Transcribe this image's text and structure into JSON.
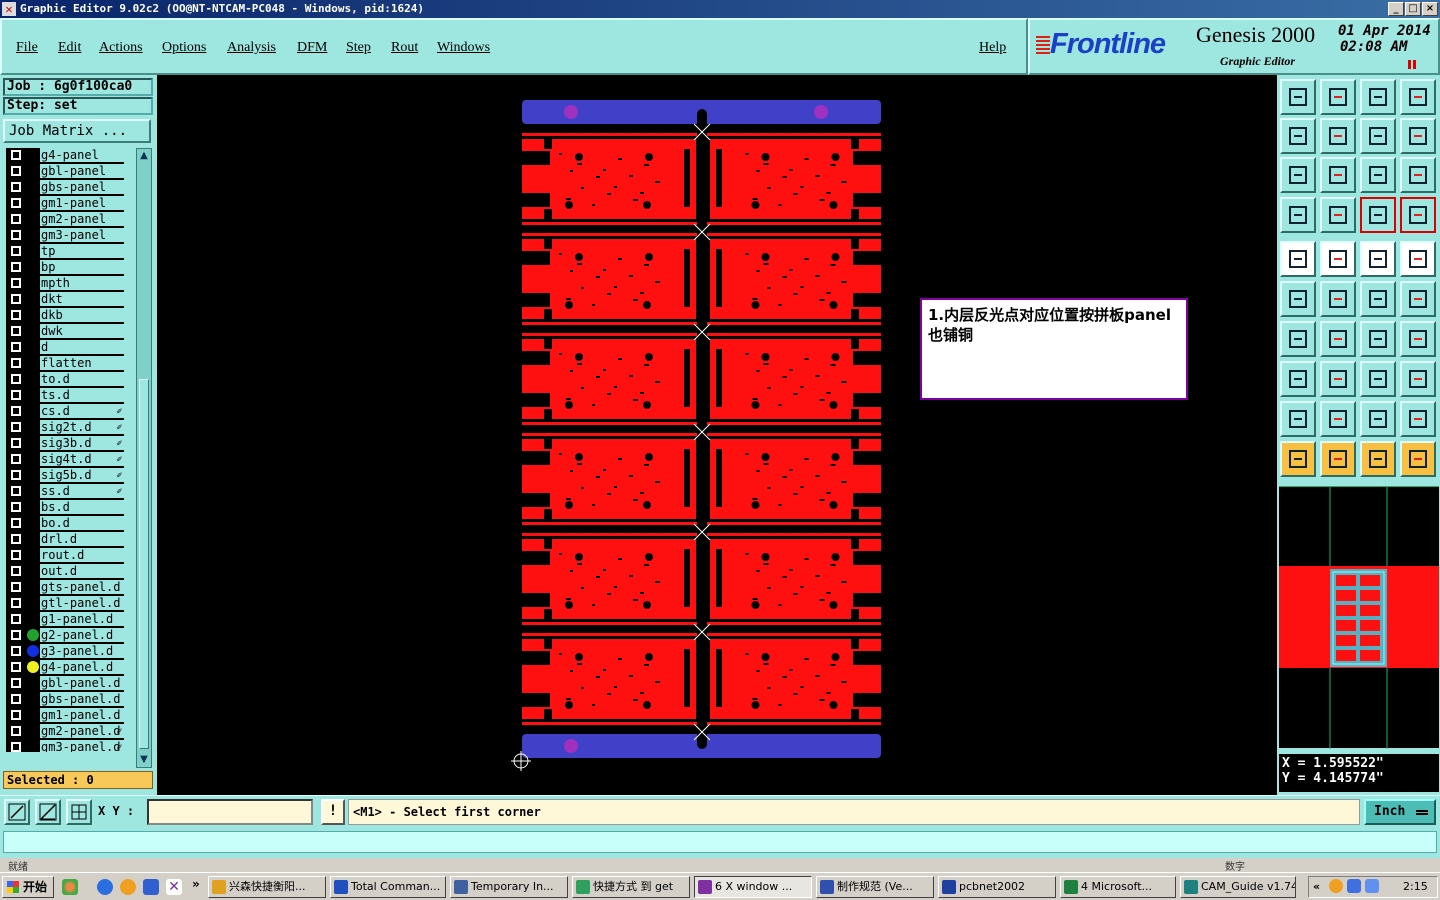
{
  "window": {
    "title": "Graphic Editor 9.02c2  (OO@NT-NTCAM-PC048 - Windows, pid:1624)",
    "buttons": {
      "minimize": "_",
      "maximize": "□",
      "close": "×"
    }
  },
  "menu": {
    "items": [
      {
        "label": "File"
      },
      {
        "label": "Edit"
      },
      {
        "label": "Actions"
      },
      {
        "label": "Options"
      },
      {
        "label": "Analysis"
      },
      {
        "label": "DFM"
      },
      {
        "label": "Step"
      },
      {
        "label": "Rout"
      },
      {
        "label": "Windows"
      }
    ],
    "help": "Help"
  },
  "brand": {
    "logo": "Frontline",
    "product": "Genesis 2000",
    "subtitle": "Graphic Editor",
    "date": "01 Apr 2014",
    "time": "02:08 AM"
  },
  "left": {
    "job": "Job : 6g0f100ca0",
    "step": "Step: set",
    "job_matrix": "Job Matrix ...",
    "selected": "Selected : 0",
    "layers": [
      {
        "name": "g4-panel",
        "color": "",
        "affected": false
      },
      {
        "name": "gbl-panel",
        "color": "",
        "affected": false
      },
      {
        "name": "gbs-panel",
        "color": "",
        "affected": false
      },
      {
        "name": "gm1-panel",
        "color": "",
        "affected": false
      },
      {
        "name": "gm2-panel",
        "color": "",
        "affected": false
      },
      {
        "name": "gm3-panel",
        "color": "",
        "affected": false
      },
      {
        "name": "tp",
        "color": "",
        "affected": false
      },
      {
        "name": "bp",
        "color": "",
        "affected": false
      },
      {
        "name": "mpth",
        "color": "",
        "affected": false
      },
      {
        "name": "dkt",
        "color": "",
        "affected": false
      },
      {
        "name": "dkb",
        "color": "",
        "affected": false
      },
      {
        "name": "dwk",
        "color": "",
        "affected": false
      },
      {
        "name": "d",
        "color": "",
        "affected": false
      },
      {
        "name": "flatten",
        "color": "",
        "affected": false
      },
      {
        "name": "to.d",
        "color": "",
        "affected": false
      },
      {
        "name": "ts.d",
        "color": "",
        "affected": false
      },
      {
        "name": "cs.d",
        "color": "",
        "affected": true
      },
      {
        "name": "sig2t.d",
        "color": "",
        "affected": true
      },
      {
        "name": "sig3b.d",
        "color": "",
        "affected": true
      },
      {
        "name": "sig4t.d",
        "color": "",
        "affected": true
      },
      {
        "name": "sig5b.d",
        "color": "",
        "affected": true
      },
      {
        "name": "ss.d",
        "color": "",
        "affected": true
      },
      {
        "name": "bs.d",
        "color": "",
        "affected": false
      },
      {
        "name": "bo.d",
        "color": "",
        "affected": false
      },
      {
        "name": "drl.d",
        "color": "",
        "affected": false
      },
      {
        "name": "rout.d",
        "color": "",
        "affected": false
      },
      {
        "name": "out.d",
        "color": "",
        "affected": false
      },
      {
        "name": "gts-panel.d",
        "color": "",
        "affected": false
      },
      {
        "name": "gtl-panel.d",
        "color": "",
        "affected": false
      },
      {
        "name": "g1-panel.d",
        "color": "",
        "affected": false
      },
      {
        "name": "g2-panel.d",
        "color": "#22a030",
        "affected": false
      },
      {
        "name": "g3-panel.d",
        "color": "#1030e0",
        "affected": false
      },
      {
        "name": "g4-panel.d",
        "color": "#f0f020",
        "affected": false
      },
      {
        "name": "gbl-panel.d",
        "color": "",
        "affected": false
      },
      {
        "name": "gbs-panel.d",
        "color": "",
        "affected": false
      },
      {
        "name": "gm1-panel.d",
        "color": "",
        "affected": false
      },
      {
        "name": "gm2-panel.d",
        "color": "",
        "affected": true
      },
      {
        "name": "gm3-panel.d",
        "color": "",
        "affected": true
      }
    ]
  },
  "canvas": {
    "note": "1.内层反光点对应位置按拼板panel也铺铜",
    "colors": {
      "copper": "#ff1010",
      "frame": "#4040c8",
      "fiducial": "#a030c0",
      "background": "#000000"
    }
  },
  "coords": {
    "x": "X = 1.595522\"",
    "y": "Y = 4.145774\""
  },
  "bottom": {
    "xy_label": "X Y :",
    "xy_value": "",
    "excl": "!",
    "prompt": "<M1> - Select first corner",
    "units": "Inch"
  },
  "status": {
    "left": "就绪",
    "right": "数字"
  },
  "taskbar": {
    "start": "开始",
    "tasks": [
      {
        "label": "兴森快捷衡阳...",
        "color": "#e0a020"
      },
      {
        "label": "Total Comman...",
        "color": "#2050c0"
      },
      {
        "label": "Temporary In...",
        "color": "#4060a0"
      },
      {
        "label": "快捷方式 到 get",
        "color": "#30a060"
      },
      {
        "label": "6 X window ...",
        "color": "#8030a0"
      },
      {
        "label": "制作规范 (Ve...",
        "color": "#3050b0"
      },
      {
        "label": "pcbnet2002",
        "color": "#2040a0"
      },
      {
        "label": "4 Microsoft...",
        "color": "#208040"
      },
      {
        "label": "CAM_Guide v1.74",
        "color": "#208080"
      }
    ],
    "clock": "2:15"
  }
}
